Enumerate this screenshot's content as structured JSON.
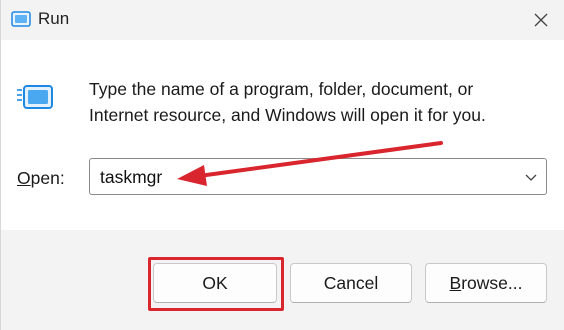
{
  "window": {
    "title": "Run",
    "title_icon": "run-app-icon",
    "close_icon": "close-icon"
  },
  "content": {
    "description_line1": "Type the name of a program, folder, document, or",
    "description_line2": "Internet resource, and Windows will open it for you.",
    "icon": "run-app-icon"
  },
  "open_field": {
    "label_accel": "O",
    "label_rest": "pen:",
    "value": "taskmgr",
    "dropdown_icon": "chevron-down-icon"
  },
  "buttons": {
    "ok": "OK",
    "cancel": "Cancel",
    "browse_accel": "B",
    "browse_rest": "rowse..."
  },
  "annotations": {
    "arrow_color": "#d9262e",
    "highlight_color": "#d9262e"
  },
  "colors": {
    "titlebar_bg": "#f3f3f3",
    "footer_bg": "#f3f3f3",
    "icon_blue": "#1e88e5"
  }
}
